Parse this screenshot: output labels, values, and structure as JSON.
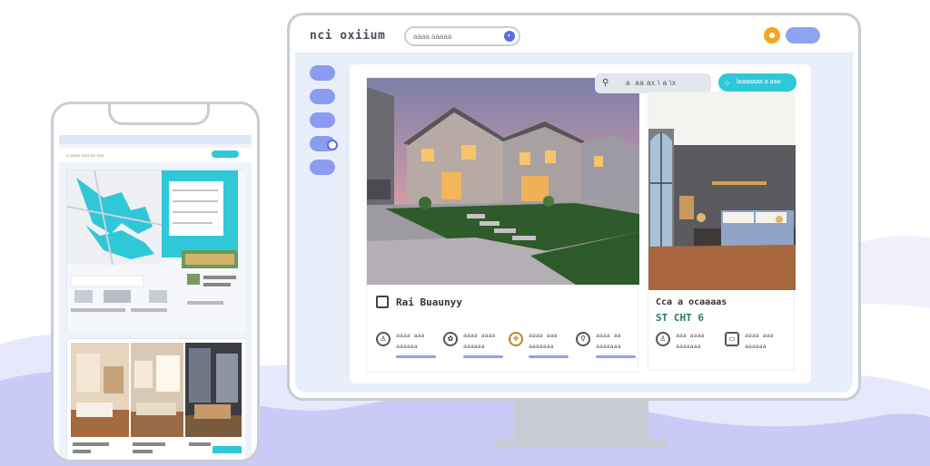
{
  "monitor": {
    "brand": "nci oxiium",
    "search_placeholder": "aaaa aaaaa",
    "mic_glyph": "◐",
    "filter_text": "a  aa ax \\ a \\x",
    "filter_icon": "filter-icon",
    "search_button_label": "laaaaaaa a aaa",
    "accent": "#2fc8d8",
    "nav_color": "#8b9cf0",
    "listings": [
      {
        "title": "Rai Buaunyy",
        "features": [
          {
            "icon": "bed-icon",
            "glyph": "♙",
            "line1": "aaaa aaa",
            "line2": "aaaaaa"
          },
          {
            "icon": "bath-icon",
            "glyph": "✿",
            "line1": "aaaa aaaa",
            "line2": "aaaaaa"
          },
          {
            "icon": "area-icon",
            "glyph": "❖",
            "line1": "aaaa aaa",
            "line2": "aaaaaaa"
          },
          {
            "icon": "location-icon",
            "glyph": "⚲",
            "line1": "aaaa aa",
            "line2": "aaaaaaa"
          }
        ]
      },
      {
        "title": "Cca a ocaaaas",
        "price": "ST CHT 6",
        "features": [
          {
            "icon": "bed-icon",
            "glyph": "♙",
            "line1": "aaa aaaa",
            "line2": "aaaaaaa"
          },
          {
            "icon": "sofa-icon",
            "glyph": "▭",
            "line1": "aaaa aaa",
            "line2": "aaaaaa"
          }
        ]
      }
    ]
  },
  "phone": {
    "search_hint": "a aaaa aaa aa aaa"
  }
}
